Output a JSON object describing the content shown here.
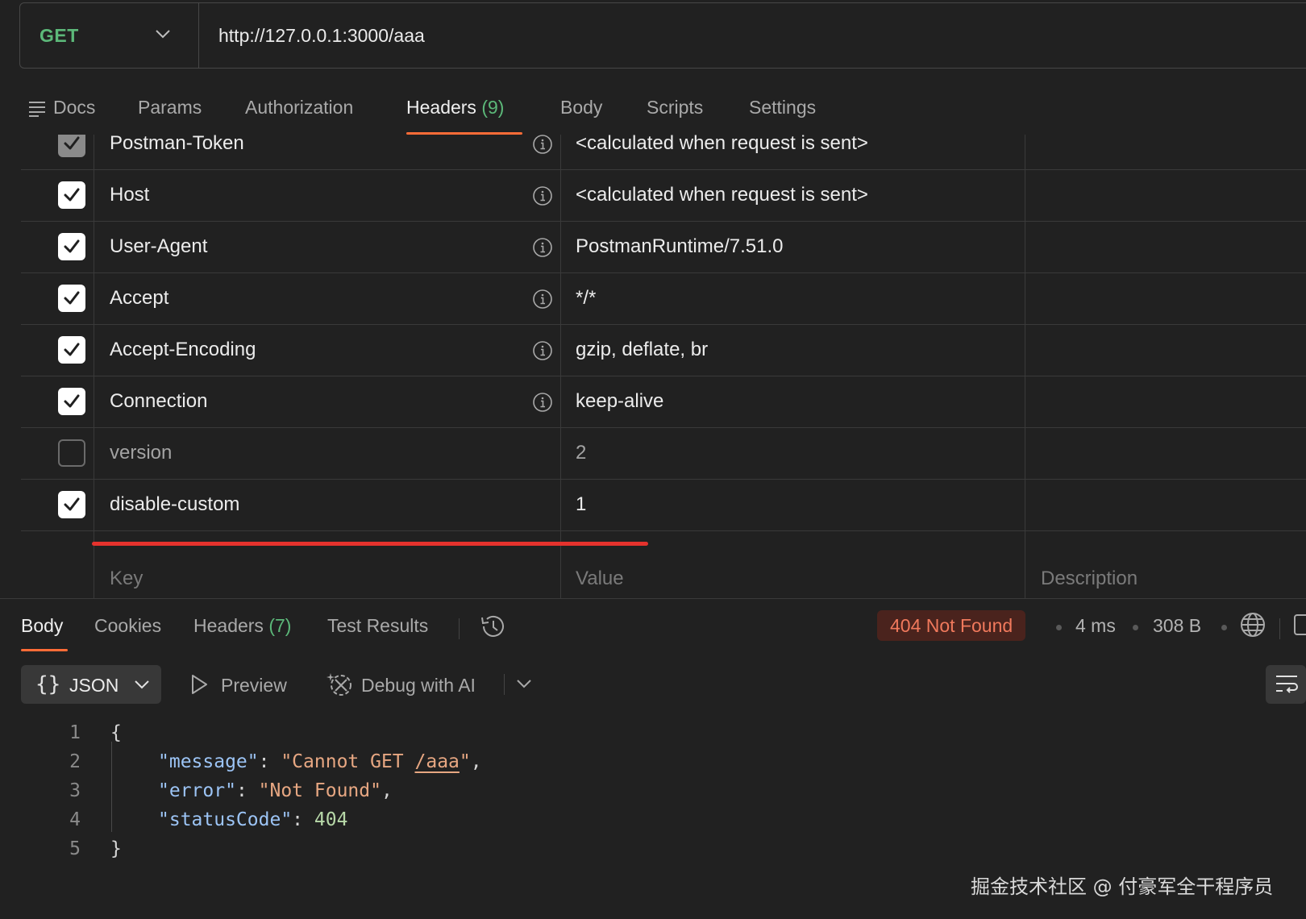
{
  "request": {
    "method": "GET",
    "url": "http://127.0.0.1:3000/aaa"
  },
  "request_tabs": {
    "docs": "Docs",
    "params": "Params",
    "authorization": "Authorization",
    "headers": "Headers",
    "headers_count": "(9)",
    "body": "Body",
    "scripts": "Scripts",
    "settings": "Settings"
  },
  "headers_table": {
    "rows": [
      {
        "key": "Postman-Token",
        "value": "<calculated when request is sent>",
        "checked": true,
        "info": true
      },
      {
        "key": "Host",
        "value": "<calculated when request is sent>",
        "checked": true,
        "info": true
      },
      {
        "key": "User-Agent",
        "value": "PostmanRuntime/7.51.0",
        "checked": true,
        "info": true
      },
      {
        "key": "Accept",
        "value": "*/*",
        "checked": true,
        "info": true
      },
      {
        "key": "Accept-Encoding",
        "value": "gzip, deflate, br",
        "checked": true,
        "info": true
      },
      {
        "key": "Connection",
        "value": "keep-alive",
        "checked": true,
        "info": true
      },
      {
        "key": "version",
        "value": "2",
        "checked": false,
        "info": false
      },
      {
        "key": "disable-custom",
        "value": "1",
        "checked": true,
        "info": false
      }
    ],
    "placeholder": {
      "key": "Key",
      "value": "Value",
      "description": "Description"
    }
  },
  "response_tabs": {
    "body": "Body",
    "cookies": "Cookies",
    "headers": "Headers",
    "headers_count": "(7)",
    "test_results": "Test Results"
  },
  "response_meta": {
    "status": "404 Not Found",
    "time": "4 ms",
    "size": "308 B"
  },
  "response_toolbar": {
    "format": "JSON",
    "preview": "Preview",
    "debug": "Debug with AI"
  },
  "response_body": {
    "line_numbers": [
      "1",
      "2",
      "3",
      "4",
      "5"
    ],
    "open_brace": "{",
    "close_brace": "}",
    "message_key": "\"message\"",
    "message_value_prefix": "\"Cannot GET ",
    "message_value_link": "/aaa",
    "message_value_suffix": "\"",
    "error_key": "\"error\"",
    "error_value": "\"Not Found\"",
    "status_key": "\"statusCode\"",
    "status_value": "404"
  },
  "watermark": "掘金技术社区 @ 付豪军全干程序员",
  "colors": {
    "background": "#212121",
    "method_green": "#5cb879",
    "tab_underline": "#ff6c37",
    "highlight_red": "#e5322d",
    "status_bg": "#4a231d",
    "status_text": "#f0795c"
  }
}
